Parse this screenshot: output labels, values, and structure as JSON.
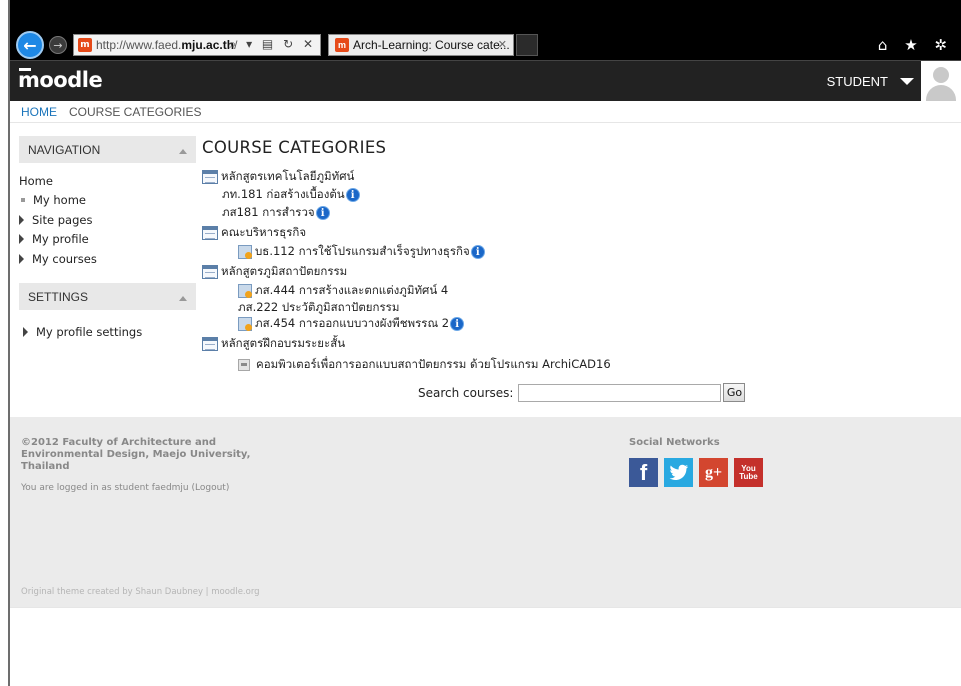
{
  "browser": {
    "back_icon": "arrow-left-icon",
    "forward_icon": "arrow-right-icon",
    "address_prefix": "http://www.faed.",
    "address_domain": "mju.ac.th",
    "address_suffix": "/",
    "address_tools": "⌕ ▾ ▤ ↻ ✕",
    "tab_title": "Arch-Learning: Course cate...",
    "tab_close": "✕",
    "toolbar_icons": "⌂ ★ ✲"
  },
  "header": {
    "logo": "moodle",
    "user_label": "STUDENT"
  },
  "breadcrumb": {
    "home": "HOME",
    "current": "COURSE CATEGORIES"
  },
  "navigation": {
    "title": "NAVIGATION",
    "home": "Home",
    "items": [
      {
        "label": "My home",
        "kind": "bullet"
      },
      {
        "label": "Site pages",
        "kind": "arrow"
      },
      {
        "label": "My profile",
        "kind": "arrow"
      },
      {
        "label": "My courses",
        "kind": "arrow"
      }
    ]
  },
  "settings": {
    "title": "SETTINGS",
    "items": [
      {
        "label": "My profile settings"
      }
    ]
  },
  "main": {
    "title": "COURSE CATEGORIES",
    "categories": [
      {
        "name": "หลักสูตรเทคโนโลยีภูมิทัศน์",
        "courses": [
          "ภท.181 ก่อสร้างเบื้องต้น",
          "ภส181 การสำรวจ"
        ]
      },
      {
        "name": "คณะบริหารธุรกิจ",
        "courses": [
          "บธ.112 การใช้โปรแกรมสำเร็จรูปทางธุรกิจ"
        ]
      },
      {
        "name": "หลักสูตรภูมิสถาปัตยกรรม",
        "courses": [
          "ภส.444 การสร้างและตกแต่งภูมิทัศน์ 4",
          "ภส.222 ประวัติภูมิสถาปัตยกรรม",
          "ภส.454 การออกแบบวางผังพืชพรรณ 2"
        ]
      },
      {
        "name": "หลักสูตรฝึกอบรมระยะสั้น",
        "courses": [
          "คอมพิวเตอร์เพื่อการออกแบบสถาปัตยกรรม ด้วยโปรแกรม ArchiCAD16"
        ]
      }
    ],
    "search_label": "Search courses:",
    "search_value": "",
    "go_label": "Go",
    "info_glyph": "i"
  },
  "footer": {
    "copyright": "©2012 Faculty of Architecture and Environmental Design, Maejo University, Thailand",
    "logged_in": "You are logged in as student faedmju (Logout)",
    "theme_credit": "Original theme created by Shaun Daubney | moodle.org",
    "social_title": "Social Networks",
    "social": [
      {
        "name": "facebook-icon",
        "glyph": "f"
      },
      {
        "name": "twitter-icon",
        "glyph": "🐦"
      },
      {
        "name": "google-plus-icon",
        "glyph": "g+"
      },
      {
        "name": "youtube-icon",
        "glyph_top": "You",
        "glyph_bottom": "Tube"
      }
    ]
  },
  "colors": {
    "link": "#1b75bb",
    "header_bg": "#222222",
    "block_header": "#e8e8e8",
    "footer_bg": "#ebebeb"
  }
}
